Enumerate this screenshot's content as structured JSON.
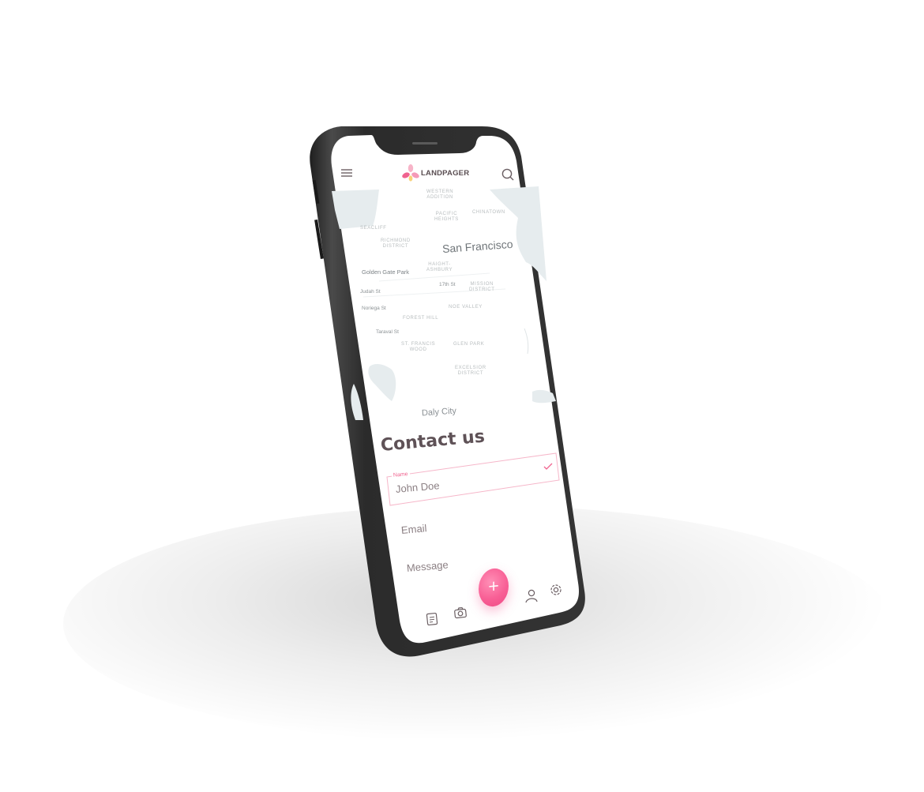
{
  "header": {
    "brand_name": "LANDPAGER",
    "menu_icon": "hamburger-menu-icon",
    "search_icon": "search-icon",
    "logo_icon": "flower-logo-icon",
    "accent_color": "#f0638f"
  },
  "map": {
    "city_name": "San Francisco",
    "secondary_city": "Daly City",
    "districts": [
      "WESTERN\nADDITION",
      "CHINATOWN",
      "PACIFIC\nHEIGHTS",
      "RICHMOND\nDISTRICT",
      "HAIGHT-\nASHBURY",
      "MISSION\nDISTRICT",
      "NOE VALLEY",
      "FOREST HILL",
      "ST. FRANCIS\nWOOD",
      "GLEN PARK",
      "EXCELSIOR\nDISTRICT",
      "SEACLIFF"
    ],
    "streets": [
      "Golden Gate Park",
      "Judah St",
      "Noriega St",
      "Taraval St",
      "17th St"
    ]
  },
  "contact": {
    "title": "Contact us",
    "name_label": "Name",
    "name_value": "John Doe",
    "email_placeholder": "Email",
    "message_placeholder": "Message"
  },
  "bottom_nav": {
    "items": [
      "news-icon",
      "camera-icon",
      "user-icon",
      "settings-icon"
    ],
    "fab_symbol": "+"
  }
}
